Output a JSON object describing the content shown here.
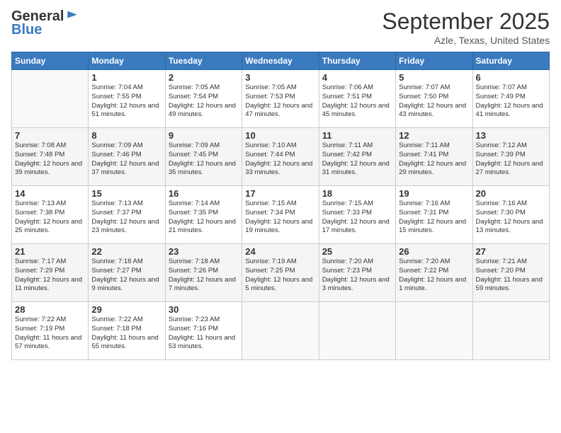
{
  "header": {
    "logo_general": "General",
    "logo_blue": "Blue",
    "month": "September 2025",
    "location": "Azle, Texas, United States"
  },
  "weekdays": [
    "Sunday",
    "Monday",
    "Tuesday",
    "Wednesday",
    "Thursday",
    "Friday",
    "Saturday"
  ],
  "weeks": [
    [
      {
        "day": "",
        "sunrise": "",
        "sunset": "",
        "daylight": ""
      },
      {
        "day": "1",
        "sunrise": "Sunrise: 7:04 AM",
        "sunset": "Sunset: 7:55 PM",
        "daylight": "Daylight: 12 hours and 51 minutes."
      },
      {
        "day": "2",
        "sunrise": "Sunrise: 7:05 AM",
        "sunset": "Sunset: 7:54 PM",
        "daylight": "Daylight: 12 hours and 49 minutes."
      },
      {
        "day": "3",
        "sunrise": "Sunrise: 7:05 AM",
        "sunset": "Sunset: 7:53 PM",
        "daylight": "Daylight: 12 hours and 47 minutes."
      },
      {
        "day": "4",
        "sunrise": "Sunrise: 7:06 AM",
        "sunset": "Sunset: 7:51 PM",
        "daylight": "Daylight: 12 hours and 45 minutes."
      },
      {
        "day": "5",
        "sunrise": "Sunrise: 7:07 AM",
        "sunset": "Sunset: 7:50 PM",
        "daylight": "Daylight: 12 hours and 43 minutes."
      },
      {
        "day": "6",
        "sunrise": "Sunrise: 7:07 AM",
        "sunset": "Sunset: 7:49 PM",
        "daylight": "Daylight: 12 hours and 41 minutes."
      }
    ],
    [
      {
        "day": "7",
        "sunrise": "Sunrise: 7:08 AM",
        "sunset": "Sunset: 7:48 PM",
        "daylight": "Daylight: 12 hours and 39 minutes."
      },
      {
        "day": "8",
        "sunrise": "Sunrise: 7:09 AM",
        "sunset": "Sunset: 7:46 PM",
        "daylight": "Daylight: 12 hours and 37 minutes."
      },
      {
        "day": "9",
        "sunrise": "Sunrise: 7:09 AM",
        "sunset": "Sunset: 7:45 PM",
        "daylight": "Daylight: 12 hours and 35 minutes."
      },
      {
        "day": "10",
        "sunrise": "Sunrise: 7:10 AM",
        "sunset": "Sunset: 7:44 PM",
        "daylight": "Daylight: 12 hours and 33 minutes."
      },
      {
        "day": "11",
        "sunrise": "Sunrise: 7:11 AM",
        "sunset": "Sunset: 7:42 PM",
        "daylight": "Daylight: 12 hours and 31 minutes."
      },
      {
        "day": "12",
        "sunrise": "Sunrise: 7:11 AM",
        "sunset": "Sunset: 7:41 PM",
        "daylight": "Daylight: 12 hours and 29 minutes."
      },
      {
        "day": "13",
        "sunrise": "Sunrise: 7:12 AM",
        "sunset": "Sunset: 7:39 PM",
        "daylight": "Daylight: 12 hours and 27 minutes."
      }
    ],
    [
      {
        "day": "14",
        "sunrise": "Sunrise: 7:13 AM",
        "sunset": "Sunset: 7:38 PM",
        "daylight": "Daylight: 12 hours and 25 minutes."
      },
      {
        "day": "15",
        "sunrise": "Sunrise: 7:13 AM",
        "sunset": "Sunset: 7:37 PM",
        "daylight": "Daylight: 12 hours and 23 minutes."
      },
      {
        "day": "16",
        "sunrise": "Sunrise: 7:14 AM",
        "sunset": "Sunset: 7:35 PM",
        "daylight": "Daylight: 12 hours and 21 minutes."
      },
      {
        "day": "17",
        "sunrise": "Sunrise: 7:15 AM",
        "sunset": "Sunset: 7:34 PM",
        "daylight": "Daylight: 12 hours and 19 minutes."
      },
      {
        "day": "18",
        "sunrise": "Sunrise: 7:15 AM",
        "sunset": "Sunset: 7:33 PM",
        "daylight": "Daylight: 12 hours and 17 minutes."
      },
      {
        "day": "19",
        "sunrise": "Sunrise: 7:16 AM",
        "sunset": "Sunset: 7:31 PM",
        "daylight": "Daylight: 12 hours and 15 minutes."
      },
      {
        "day": "20",
        "sunrise": "Sunrise: 7:16 AM",
        "sunset": "Sunset: 7:30 PM",
        "daylight": "Daylight: 12 hours and 13 minutes."
      }
    ],
    [
      {
        "day": "21",
        "sunrise": "Sunrise: 7:17 AM",
        "sunset": "Sunset: 7:29 PM",
        "daylight": "Daylight: 12 hours and 11 minutes."
      },
      {
        "day": "22",
        "sunrise": "Sunrise: 7:18 AM",
        "sunset": "Sunset: 7:27 PM",
        "daylight": "Daylight: 12 hours and 9 minutes."
      },
      {
        "day": "23",
        "sunrise": "Sunrise: 7:18 AM",
        "sunset": "Sunset: 7:26 PM",
        "daylight": "Daylight: 12 hours and 7 minutes."
      },
      {
        "day": "24",
        "sunrise": "Sunrise: 7:19 AM",
        "sunset": "Sunset: 7:25 PM",
        "daylight": "Daylight: 12 hours and 5 minutes."
      },
      {
        "day": "25",
        "sunrise": "Sunrise: 7:20 AM",
        "sunset": "Sunset: 7:23 PM",
        "daylight": "Daylight: 12 hours and 3 minutes."
      },
      {
        "day": "26",
        "sunrise": "Sunrise: 7:20 AM",
        "sunset": "Sunset: 7:22 PM",
        "daylight": "Daylight: 12 hours and 1 minute."
      },
      {
        "day": "27",
        "sunrise": "Sunrise: 7:21 AM",
        "sunset": "Sunset: 7:20 PM",
        "daylight": "Daylight: 11 hours and 59 minutes."
      }
    ],
    [
      {
        "day": "28",
        "sunrise": "Sunrise: 7:22 AM",
        "sunset": "Sunset: 7:19 PM",
        "daylight": "Daylight: 11 hours and 57 minutes."
      },
      {
        "day": "29",
        "sunrise": "Sunrise: 7:22 AM",
        "sunset": "Sunset: 7:18 PM",
        "daylight": "Daylight: 11 hours and 55 minutes."
      },
      {
        "day": "30",
        "sunrise": "Sunrise: 7:23 AM",
        "sunset": "Sunset: 7:16 PM",
        "daylight": "Daylight: 11 hours and 53 minutes."
      },
      {
        "day": "",
        "sunrise": "",
        "sunset": "",
        "daylight": ""
      },
      {
        "day": "",
        "sunrise": "",
        "sunset": "",
        "daylight": ""
      },
      {
        "day": "",
        "sunrise": "",
        "sunset": "",
        "daylight": ""
      },
      {
        "day": "",
        "sunrise": "",
        "sunset": "",
        "daylight": ""
      }
    ]
  ]
}
